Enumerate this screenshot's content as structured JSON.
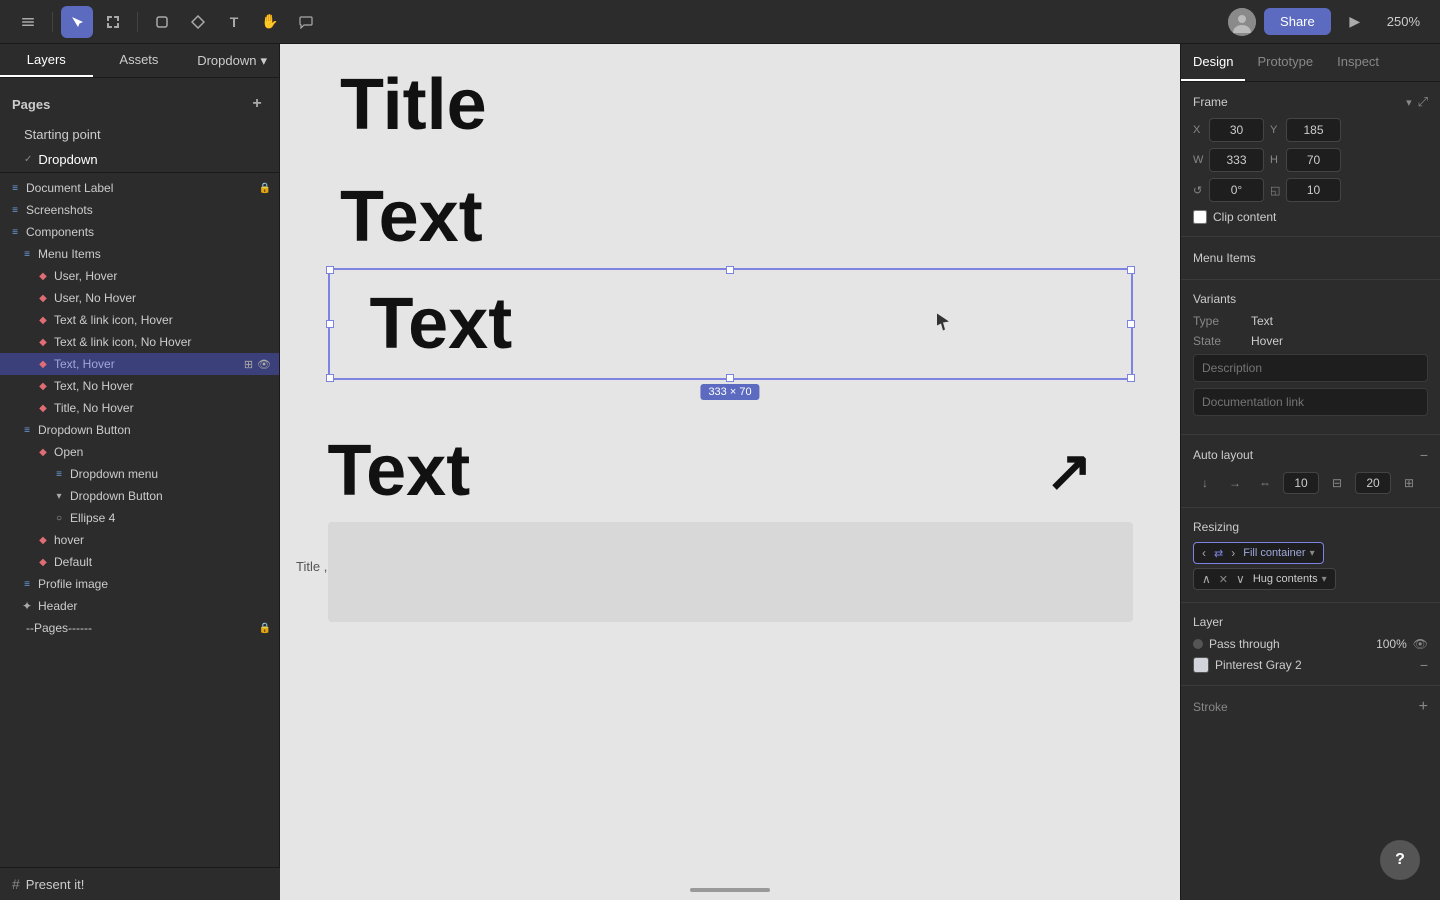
{
  "toolbar": {
    "share_label": "Share",
    "zoom_level": "250%",
    "play_icon": "▶",
    "chevron_down": "▾"
  },
  "left_panel": {
    "tabs": {
      "layers_label": "Layers",
      "assets_label": "Assets",
      "dropdown_label": "Dropdown"
    },
    "pages_header": "Pages",
    "add_icon": "+",
    "pages": [
      {
        "label": "Starting point",
        "active": false
      },
      {
        "label": "Dropdown",
        "active": true
      }
    ],
    "layers": [
      {
        "label": "Document Label",
        "icon": "≡",
        "indent": 0,
        "has_lock": true
      },
      {
        "label": "Screenshots",
        "icon": "≡",
        "indent": 0
      },
      {
        "label": "Components",
        "icon": "≡",
        "indent": 0
      },
      {
        "label": "Menu Items",
        "icon": "≡",
        "indent": 1
      },
      {
        "label": "User, Hover",
        "icon": "◆",
        "indent": 2
      },
      {
        "label": "User, No Hover",
        "icon": "◆",
        "indent": 2
      },
      {
        "label": "Text & link icon, Hover",
        "icon": "◆",
        "indent": 2
      },
      {
        "label": "Text & link icon, No Hover",
        "icon": "◆",
        "indent": 2
      },
      {
        "label": "Text, Hover",
        "icon": "◆",
        "indent": 2,
        "selected": true
      },
      {
        "label": "Text, No Hover",
        "icon": "◆",
        "indent": 2
      },
      {
        "label": "Title, No Hover",
        "icon": "◆",
        "indent": 2
      },
      {
        "label": "Dropdown Button",
        "icon": "≡",
        "indent": 1
      },
      {
        "label": "Open",
        "icon": "◆",
        "indent": 2
      },
      {
        "label": "Dropdown menu",
        "icon": "≡",
        "indent": 3
      },
      {
        "label": "Dropdown Button",
        "icon": "▾",
        "indent": 3
      },
      {
        "label": "Ellipse 4",
        "icon": "○",
        "indent": 3
      },
      {
        "label": "hover",
        "icon": "◆",
        "indent": 2
      },
      {
        "label": "Default",
        "icon": "◆",
        "indent": 2
      },
      {
        "label": "Profile image",
        "icon": "≡",
        "indent": 1
      },
      {
        "label": "Header",
        "icon": "✦",
        "indent": 1
      },
      {
        "label": "--Pages------",
        "icon": "",
        "indent": 0,
        "has_lock": true
      }
    ]
  },
  "canvas": {
    "title_text": "Title",
    "text_rows": [
      "Text",
      "Text",
      "Text"
    ],
    "frame_size": "333 × 70",
    "hover_label": "Title , Hover",
    "present_label": "Present it!"
  },
  "right_panel": {
    "tabs": [
      "Design",
      "Prototype",
      "Inspect"
    ],
    "active_tab": "Design",
    "frame_section": {
      "title": "Frame",
      "x_label": "X",
      "x_value": "30",
      "y_label": "Y",
      "y_value": "185",
      "w_label": "W",
      "w_value": "333",
      "h_label": "H",
      "h_value": "70",
      "rotation_label": "↺",
      "rotation_value": "0°",
      "corner_label": "◱",
      "corner_value": "10",
      "clip_content_label": "Clip content",
      "expand_icon": "⤢"
    },
    "menu_items_section": {
      "title": "Menu Items"
    },
    "variants_section": {
      "title": "Variants",
      "type_label": "Type",
      "type_value": "Text",
      "state_label": "State",
      "state_value": "Hover",
      "description_placeholder": "Description",
      "doc_link_placeholder": "Documentation link"
    },
    "auto_layout_section": {
      "title": "Auto layout",
      "gap_value": "10",
      "padding_value": "20",
      "minus_icon": "−"
    },
    "resizing_section": {
      "title": "Resizing",
      "fill_container_label": "Fill container",
      "hug_contents_label": "Hug contents",
      "chevron_down": "▾"
    },
    "layer_section": {
      "title": "Layer",
      "blend_label": "Pass through",
      "opacity_value": "100%",
      "eye_icon": "👁"
    },
    "color_section": {
      "color_name": "Pinterest Gray 2",
      "minus_icon": "−"
    },
    "stroke_section": {
      "title": "Stroke",
      "add_icon": "+"
    }
  },
  "help_button": "?"
}
